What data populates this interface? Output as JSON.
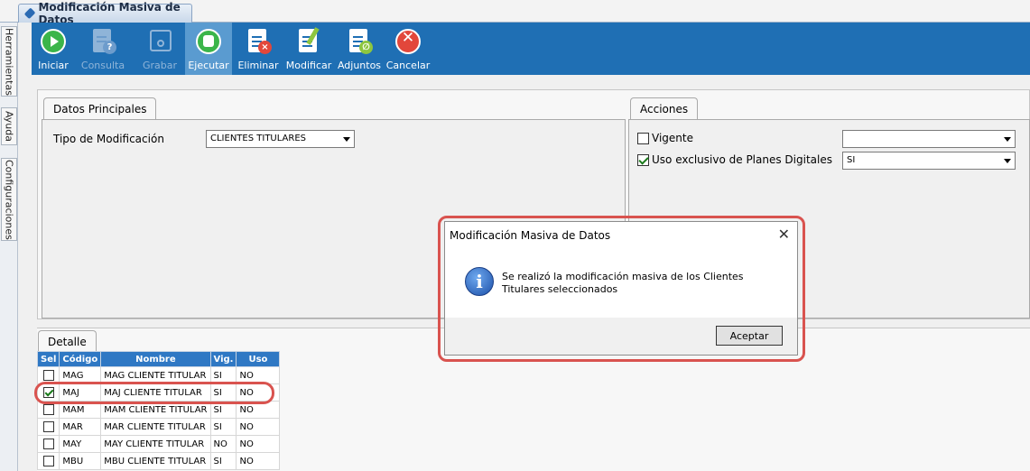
{
  "window": {
    "tab_title": "Modificación Masiva de Datos"
  },
  "sidebar": {
    "tabs": [
      "Herramientas",
      "Ayuda",
      "Configuraciones"
    ]
  },
  "toolbar": {
    "iniciar": "Iniciar",
    "consulta": "Consulta",
    "grabar": "Grabar",
    "ejecutar": "Ejecutar",
    "eliminar": "Eliminar",
    "modificar": "Modificar",
    "adjuntos": "Adjuntos",
    "cancelar": "Cancelar"
  },
  "datos_principales": {
    "tab": "Datos Principales",
    "tipo_label": "Tipo de Modificación",
    "tipo_value": "CLIENTES TITULARES"
  },
  "acciones": {
    "tab": "Acciones",
    "vigente_label": "Vigente",
    "vigente_checked": false,
    "vigente_value": "",
    "uso_label": "Uso exclusivo de Planes Digitales",
    "uso_checked": true,
    "uso_value": "SI"
  },
  "detalle": {
    "tab": "Detalle",
    "columns": [
      "Sel",
      "Código",
      "Nombre",
      "Vig.",
      "Uso"
    ],
    "rows": [
      {
        "sel": false,
        "codigo": "MAG",
        "nombre": "MAG CLIENTE TITULAR",
        "vig": "SI",
        "uso": "NO"
      },
      {
        "sel": true,
        "codigo": "MAJ",
        "nombre": "MAJ CLIENTE TITULAR",
        "vig": "SI",
        "uso": "NO"
      },
      {
        "sel": false,
        "codigo": "MAM",
        "nombre": "MAM CLIENTE TITULAR",
        "vig": "SI",
        "uso": "NO"
      },
      {
        "sel": false,
        "codigo": "MAR",
        "nombre": "MAR CLIENTE TITULAR",
        "vig": "SI",
        "uso": "NO"
      },
      {
        "sel": false,
        "codigo": "MAY",
        "nombre": "MAY CLIENTE TITULAR",
        "vig": "NO",
        "uso": "NO"
      },
      {
        "sel": false,
        "codigo": "MBU",
        "nombre": "MBU CLIENTE TITULAR",
        "vig": "SI",
        "uso": "NO"
      }
    ]
  },
  "dialog": {
    "title": "Modificación Masiva de Datos",
    "close": "✕",
    "message": "Se realizó la modificación masiva de los Clientes Titulares seleccionados",
    "button": "Aceptar"
  },
  "colors": {
    "toolbar": "#1f6fb4",
    "grid_header": "#2f78c4",
    "highlight": "#d9534f"
  }
}
